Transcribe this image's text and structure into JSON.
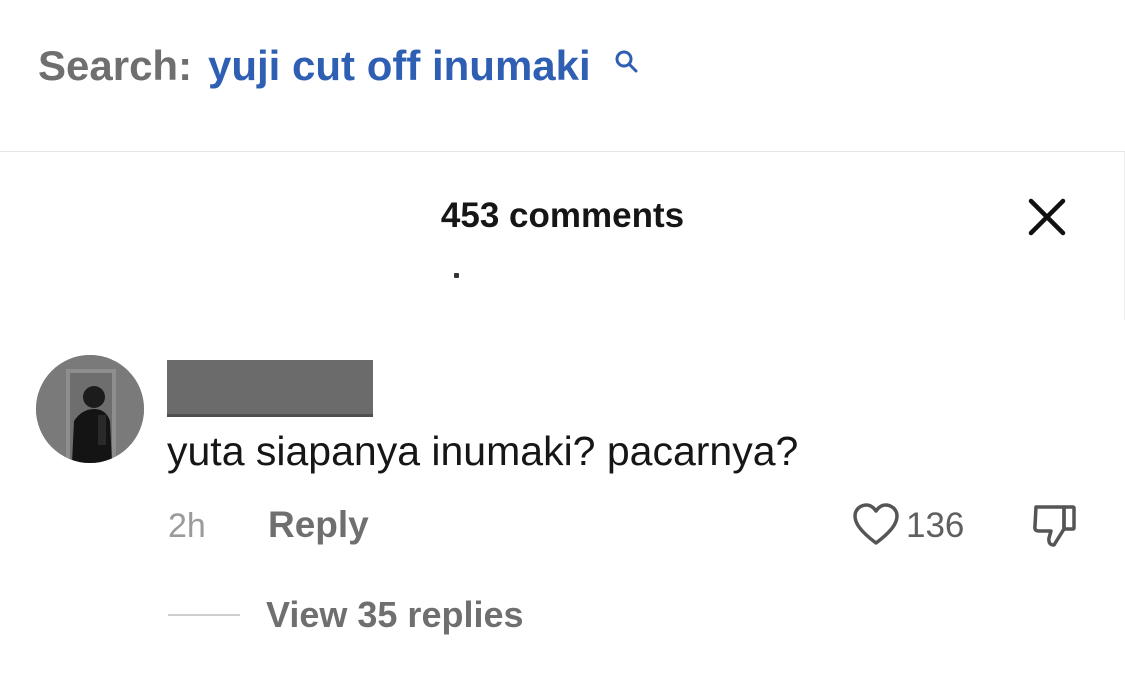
{
  "search": {
    "prefix": "Search:",
    "query": "yuji cut off inumaki",
    "icon": "search-icon"
  },
  "comments_panel": {
    "count_label": "453 comments",
    "close_icon": "close-icon"
  },
  "comment": {
    "avatar": "avatar",
    "username_redacted": true,
    "text": "yuta siapanya inumaki? pacarnya?",
    "time": "2h",
    "reply_label": "Reply",
    "like_icon": "heart-icon",
    "like_count": "136",
    "dislike_icon": "thumbs-down-icon",
    "view_replies_label": "View 35 replies"
  },
  "colors": {
    "query_blue": "#2f5fb3",
    "text_dark": "#161616",
    "text_gray": "#6f6f6f"
  }
}
